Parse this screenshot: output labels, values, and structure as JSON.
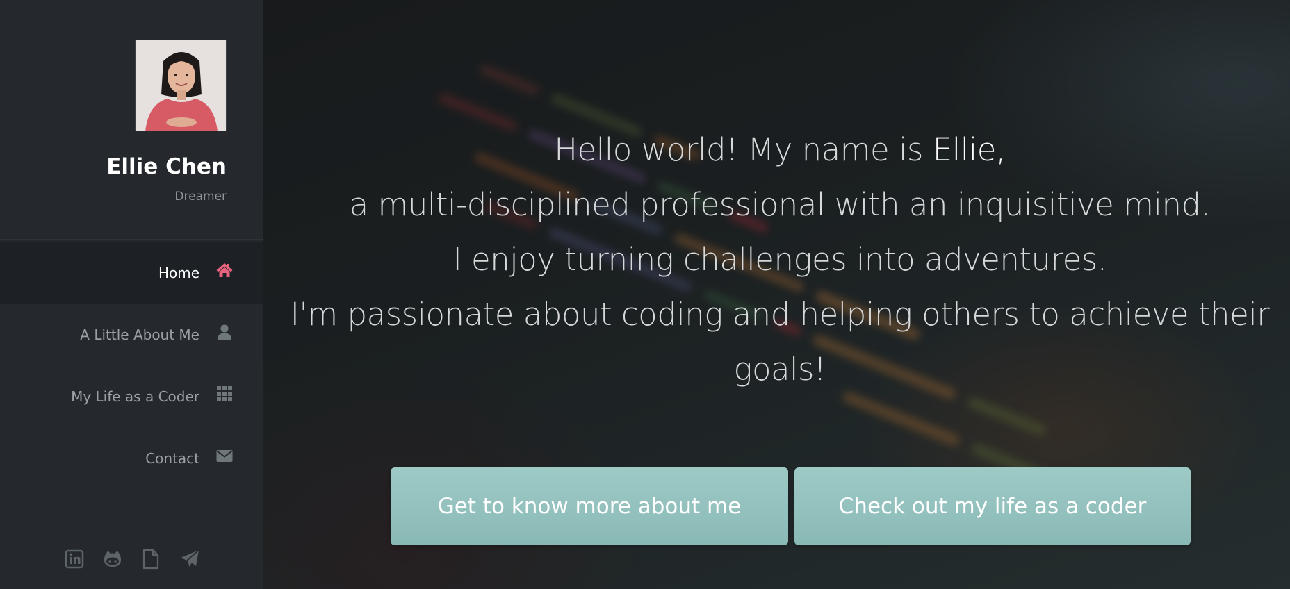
{
  "profile": {
    "name": "Ellie Chen",
    "tagline": "Dreamer"
  },
  "nav": {
    "items": [
      {
        "label": "Home",
        "icon": "home-icon",
        "active": true
      },
      {
        "label": "A Little About Me",
        "icon": "user-icon",
        "active": false
      },
      {
        "label": "My Life as a Coder",
        "icon": "grid-icon",
        "active": false
      },
      {
        "label": "Contact",
        "icon": "envelope-icon",
        "active": false
      }
    ]
  },
  "social": [
    "linkedin-icon",
    "github-icon",
    "document-icon",
    "send-icon"
  ],
  "intro": {
    "line1_prefix": "Hello world! My name is ",
    "line1_name": "Ellie,",
    "line2": "a multi-disciplined professional with an inquisitive mind.",
    "line3": "I enjoy turning challenges into adventures.",
    "line4": "I'm passionate about coding and helping others to achieve their",
    "line5": "goals!"
  },
  "buttons": {
    "about": "Get to know more about me",
    "coder": "Check out my life as a coder"
  },
  "colors": {
    "accent": "#e8637d",
    "sidebar": "#25292d",
    "sidebar_active": "#1d2024",
    "button": "#93c1bd"
  }
}
